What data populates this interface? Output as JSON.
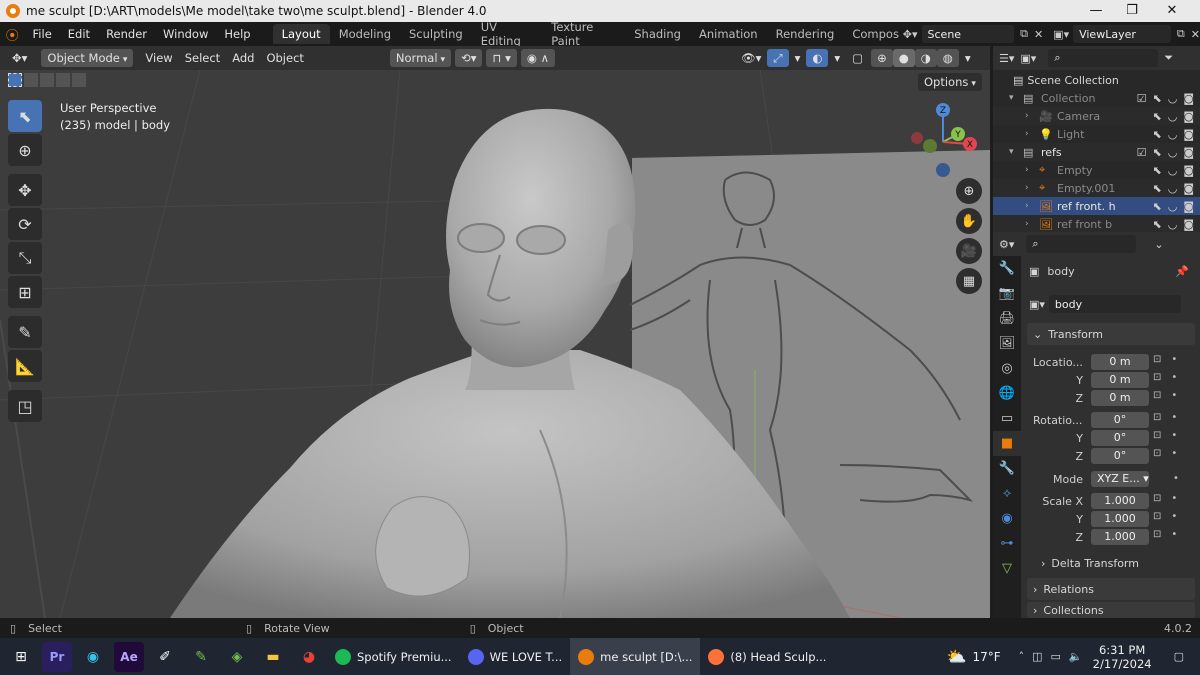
{
  "window": {
    "title": "me sculpt [D:\\ART\\models\\Me model\\take two\\me sculpt.blend] - Blender 4.0"
  },
  "menu": [
    "File",
    "Edit",
    "Render",
    "Window",
    "Help"
  ],
  "workspaces": [
    "Layout",
    "Modeling",
    "Sculpting",
    "UV Editing",
    "Texture Paint",
    "Shading",
    "Animation",
    "Rendering",
    "Compositing"
  ],
  "scene": {
    "name": "Scene",
    "view_layer": "ViewLayer"
  },
  "viewport_header": {
    "mode": "Object Mode",
    "menus": [
      "View",
      "Select",
      "Add",
      "Object"
    ],
    "orientation": "Normal",
    "options_label": "Options"
  },
  "viewport": {
    "view_name": "User Perspective",
    "object_info": "(235) model | body",
    "gizmo_axes": {
      "x": "X",
      "y": "Y",
      "z": "Z"
    }
  },
  "outliner": {
    "root": "Scene Collection",
    "rows": [
      {
        "label": "Collection",
        "dim": true
      },
      {
        "label": "Camera",
        "dim": true
      },
      {
        "label": "Light",
        "dim": true
      },
      {
        "label": "refs",
        "dim": false
      },
      {
        "label": "Empty",
        "dim": true
      },
      {
        "label": "Empty.001",
        "dim": true
      },
      {
        "label": "ref front. h",
        "dim": false
      },
      {
        "label": "ref front b",
        "dim": true
      }
    ]
  },
  "properties": {
    "object_name": "body",
    "data_name": "body",
    "transform_label": "Transform",
    "location_label": "Locatio...",
    "location": [
      "0 m",
      "0 m",
      "0 m"
    ],
    "rotation_label": "Rotatio...",
    "rotation": [
      "0°",
      "0°",
      "0°"
    ],
    "mode_label": "Mode",
    "mode_value": "XYZ E...",
    "scale_label": "Scale X",
    "scale": [
      "1.000",
      "1.000",
      "1.000"
    ],
    "axis_y": "Y",
    "axis_z": "Z",
    "delta_transform": "Delta Transform",
    "relations": "Relations",
    "collections": "Collections"
  },
  "statusbar": {
    "select": "Select",
    "rotate": "Rotate View",
    "object": "Object",
    "version": "4.0.2"
  },
  "taskbar": {
    "apps": [
      {
        "label": "Spotify Premiu...",
        "color": "#1db954"
      },
      {
        "label": "WE LOVE T...",
        "color": "#5865f2"
      },
      {
        "label": "me sculpt [D:\\...",
        "color": "#e87d0d"
      },
      {
        "label": "(8) Head Sculp...",
        "color": "#ff7139"
      }
    ],
    "weather": "17°F",
    "time": "6:31 PM",
    "date": "2/17/2024"
  },
  "colors": {
    "accent": "#4772b3",
    "x_axis": "#e0484f",
    "y_axis": "#8bc34a",
    "z_axis": "#4f8ad8",
    "blender_orange": "#e87d0d"
  }
}
